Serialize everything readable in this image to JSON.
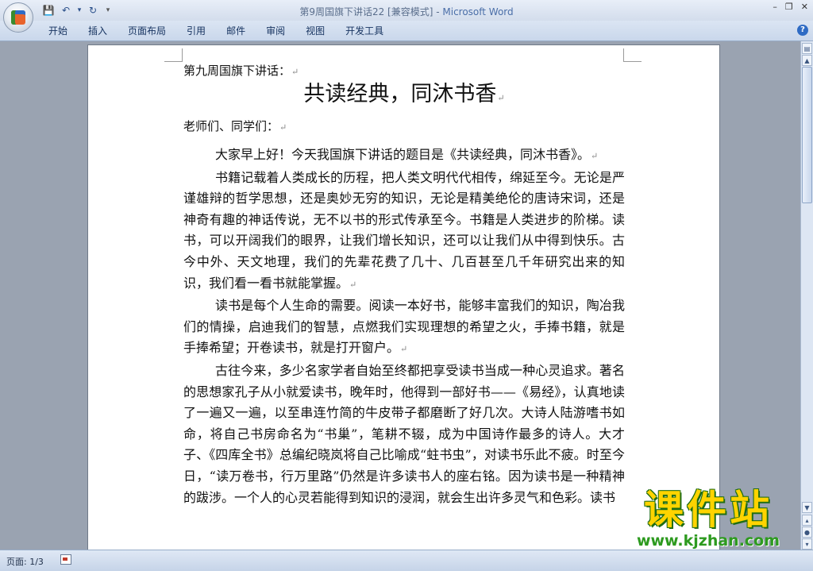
{
  "window": {
    "title_doc": "第9周国旗下讲话22 [兼容模式] - ",
    "title_app": "Microsoft Word",
    "controls": [
      "–",
      "❐",
      "✕"
    ]
  },
  "quick_access": {
    "save": "💾",
    "undo": "↶",
    "undo_arrow": "▾",
    "redo": "↻",
    "customize": "▾"
  },
  "ribbon": {
    "tabs": [
      "开始",
      "插入",
      "页面布局",
      "引用",
      "邮件",
      "审阅",
      "视图",
      "开发工具"
    ],
    "help": "?"
  },
  "document": {
    "label": "第九周国旗下讲话：",
    "title": "共读经典，同沐书香",
    "greeting": "老师们、同学们：",
    "paragraphs": [
      "大家早上好！今天我国旗下讲话的题目是《共读经典，同沐书香》。",
      "书籍记载着人类成长的历程，把人类文明代代相传，绵延至今。无论是严谨雄辩的哲学思想，还是奥妙无穷的知识，无论是精美绝伦的唐诗宋词，还是神奇有趣的神话传说，无不以书的形式传承至今。书籍是人类进步的阶梯。读书，可以开阔我们的眼界，让我们增长知识，还可以让我们从中得到快乐。古今中外、天文地理，我们的先辈花费了几十、几百甚至几千年研究出来的知识，我们看一看书就能掌握。",
      "读书是每个人生命的需要。阅读一本好书，能够丰富我们的知识，陶冶我们的情操，启迪我们的智慧，点燃我们实现理想的希望之火，手捧书籍，就是手捧希望；开卷读书，就是打开窗户。",
      "古往今来，多少名家学者自始至终都把享受读书当成一种心灵追求。著名的思想家孔子从小就爱读书，晚年时，他得到一部好书——《易经》，认真地读了一遍又一遍，以至串连竹简的牛皮带子都磨断了好几次。大诗人陆游嗜书如命，将自己书房命名为“书巢”，笔耕不辍，成为中国诗作最多的诗人。大才子、《四库全书》总编纪晓岚将自己比喻成“蛀书虫”，对读书乐此不疲。时至今日，“读万卷书，行万里路”仍然是许多读书人的座右铭。因为读书是一种精神的跋涉。一个人的心灵若能得到知识的浸润，就会生出许多灵气和色彩。读书"
    ],
    "paragraph_mark": "↵"
  },
  "statusbar": {
    "page": "页面: 1/3"
  },
  "watermark": {
    "main": "课件站",
    "url": "www.kjzhan.com"
  }
}
